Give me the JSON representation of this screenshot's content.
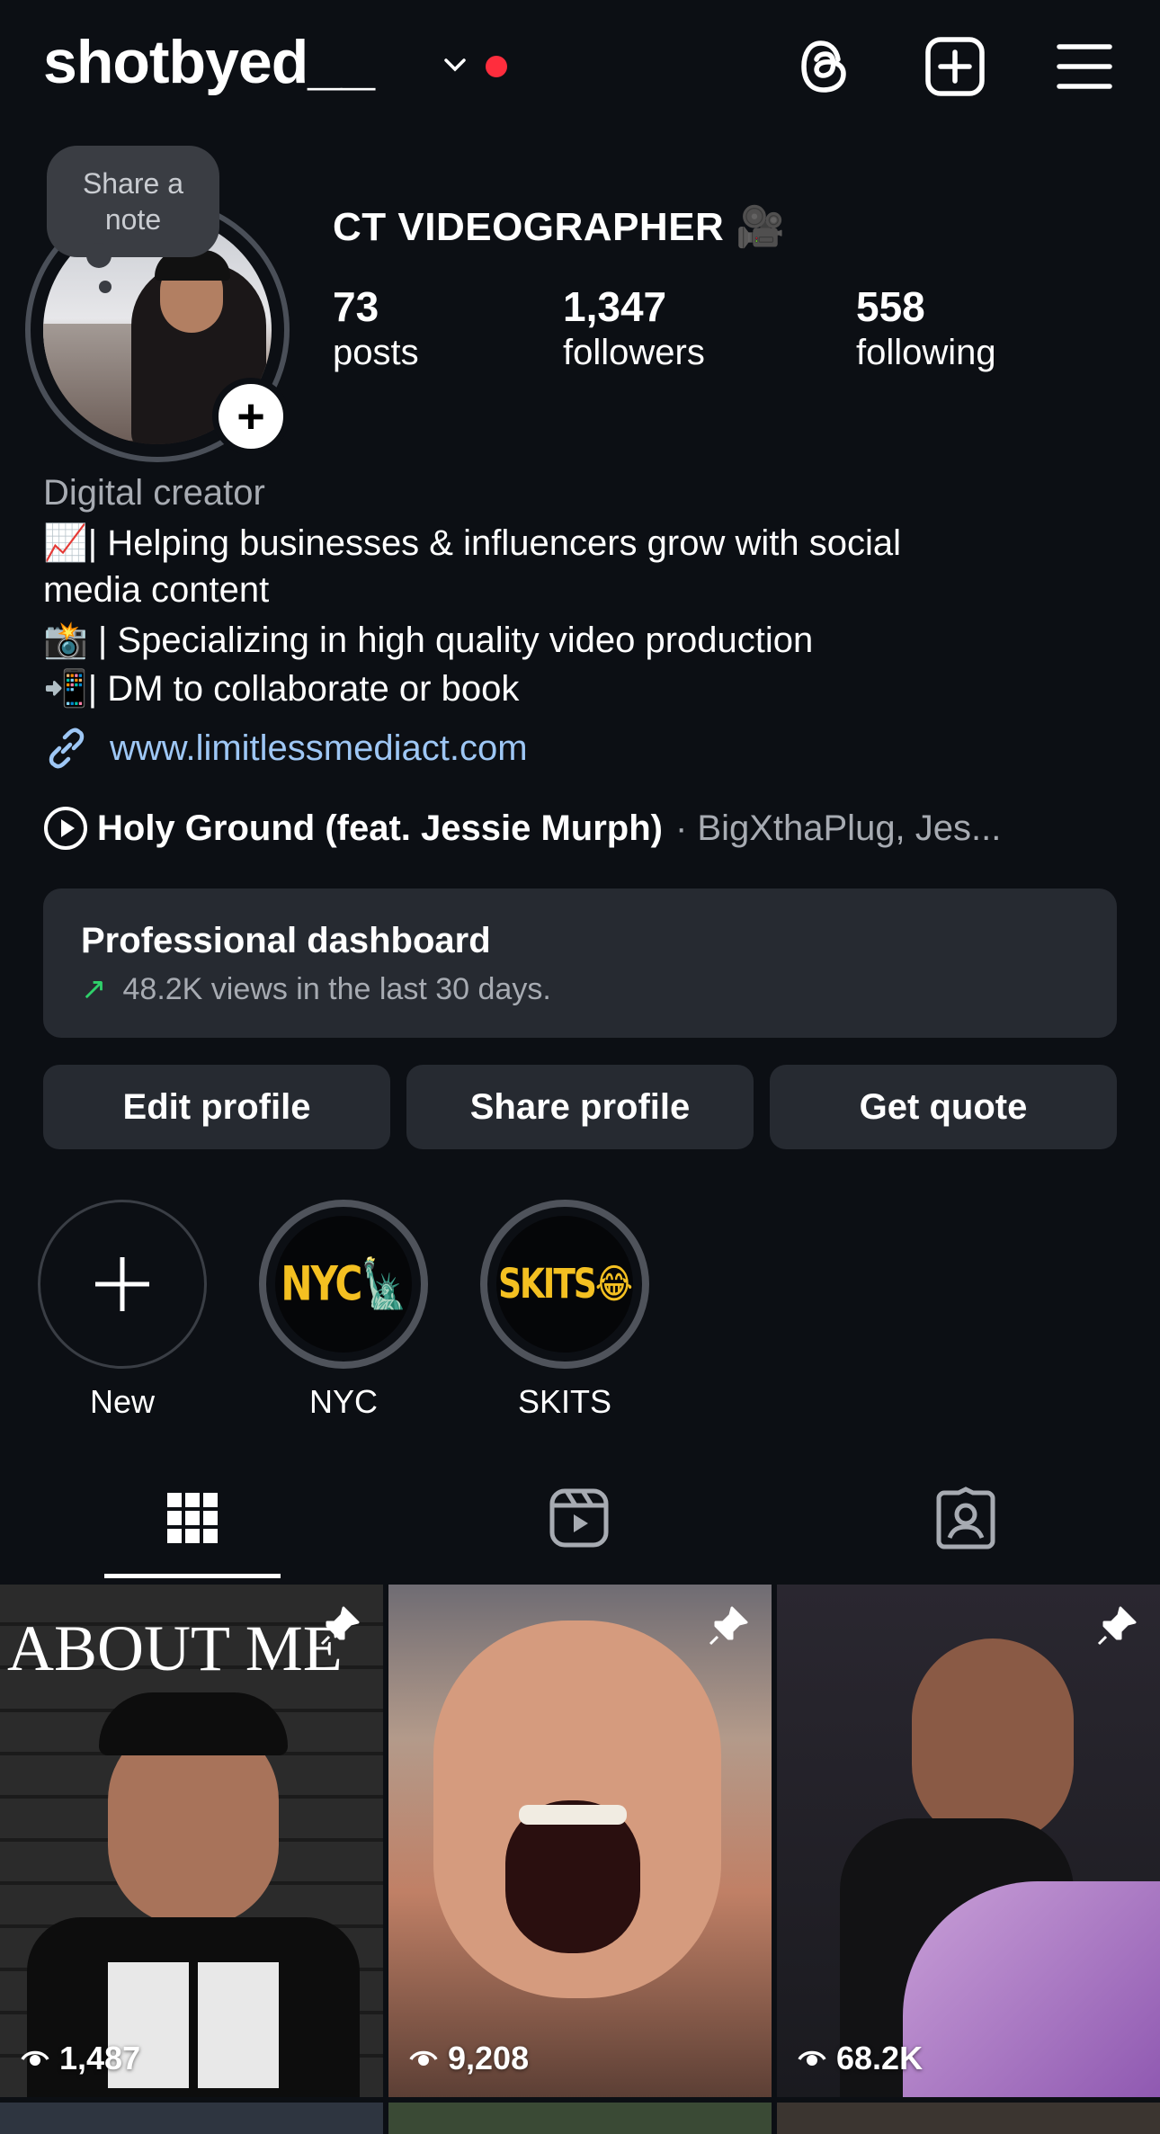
{
  "header": {
    "username": "shotbyed__",
    "icons": [
      "threads-icon",
      "create-post-icon",
      "menu-icon"
    ]
  },
  "profile": {
    "note_text": "Share a note",
    "display_name": "CT VIDEOGRAPHER 🎥",
    "stats": [
      {
        "value": "73",
        "label": "posts"
      },
      {
        "value": "1,347",
        "label": "followers"
      },
      {
        "value": "558",
        "label": "following"
      }
    ],
    "category": "Digital creator",
    "bio_lines": [
      "📈| Helping businesses & influencers grow with social",
      "media content",
      "📸 | Specializing in high quality video production",
      "📲| DM to collaborate or book"
    ],
    "link": "www.limitlessmediact.com",
    "music": {
      "title": "Holy Ground (feat. Jessie Murph)",
      "artist": "· BigXthaPlug, Jes..."
    }
  },
  "dashboard": {
    "title": "Professional dashboard",
    "subtitle": "48.2K views in the last 30 days."
  },
  "buttons": {
    "edit": "Edit profile",
    "share": "Share profile",
    "quote": "Get quote"
  },
  "highlights": [
    {
      "label": "New",
      "cover": ""
    },
    {
      "label": "NYC",
      "cover": "NYC🗽"
    },
    {
      "label": "SKITS",
      "cover": "SKITS😂"
    }
  ],
  "tabs": [
    "grid",
    "reels",
    "tagged"
  ],
  "posts": [
    {
      "overlay_text": "ABOUT ME",
      "views": "1,487",
      "pinned": true
    },
    {
      "overlay_text": "",
      "views": "9,208",
      "pinned": true
    },
    {
      "overlay_text": "",
      "views": "68.2K",
      "pinned": true
    }
  ],
  "colors": {
    "background": "#0c0f14",
    "card": "#262a31",
    "link": "#9ec7f5",
    "notification_dot": "#ff2d3d",
    "trend_up": "#2fd06a",
    "highlight_text": "#f4c021"
  }
}
